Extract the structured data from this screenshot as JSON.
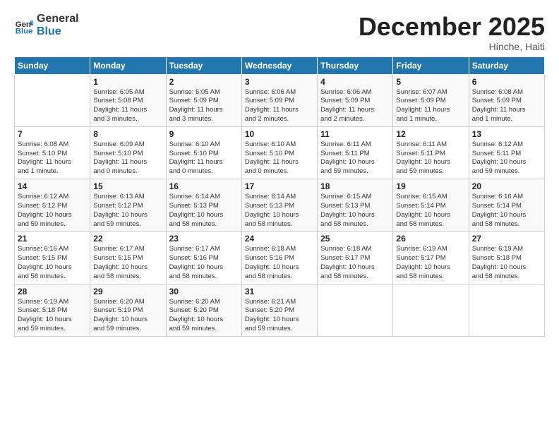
{
  "header": {
    "logo_general": "General",
    "logo_blue": "Blue",
    "title": "December 2025",
    "subtitle": "Hinche, Haiti"
  },
  "days_of_week": [
    "Sunday",
    "Monday",
    "Tuesday",
    "Wednesday",
    "Thursday",
    "Friday",
    "Saturday"
  ],
  "weeks": [
    [
      {
        "day": "",
        "info": ""
      },
      {
        "day": "1",
        "info": "Sunrise: 6:05 AM\nSunset: 5:08 PM\nDaylight: 11 hours\nand 3 minutes."
      },
      {
        "day": "2",
        "info": "Sunrise: 6:05 AM\nSunset: 5:09 PM\nDaylight: 11 hours\nand 3 minutes."
      },
      {
        "day": "3",
        "info": "Sunrise: 6:06 AM\nSunset: 5:09 PM\nDaylight: 11 hours\nand 2 minutes."
      },
      {
        "day": "4",
        "info": "Sunrise: 6:06 AM\nSunset: 5:09 PM\nDaylight: 11 hours\nand 2 minutes."
      },
      {
        "day": "5",
        "info": "Sunrise: 6:07 AM\nSunset: 5:09 PM\nDaylight: 11 hours\nand 1 minute."
      },
      {
        "day": "6",
        "info": "Sunrise: 6:08 AM\nSunset: 5:09 PM\nDaylight: 11 hours\nand 1 minute."
      }
    ],
    [
      {
        "day": "7",
        "info": "Sunrise: 6:08 AM\nSunset: 5:10 PM\nDaylight: 11 hours\nand 1 minute."
      },
      {
        "day": "8",
        "info": "Sunrise: 6:09 AM\nSunset: 5:10 PM\nDaylight: 11 hours\nand 0 minutes."
      },
      {
        "day": "9",
        "info": "Sunrise: 6:10 AM\nSunset: 5:10 PM\nDaylight: 11 hours\nand 0 minutes."
      },
      {
        "day": "10",
        "info": "Sunrise: 6:10 AM\nSunset: 5:10 PM\nDaylight: 11 hours\nand 0 minutes."
      },
      {
        "day": "11",
        "info": "Sunrise: 6:11 AM\nSunset: 5:11 PM\nDaylight: 10 hours\nand 59 minutes."
      },
      {
        "day": "12",
        "info": "Sunrise: 6:11 AM\nSunset: 5:11 PM\nDaylight: 10 hours\nand 59 minutes."
      },
      {
        "day": "13",
        "info": "Sunrise: 6:12 AM\nSunset: 5:11 PM\nDaylight: 10 hours\nand 59 minutes."
      }
    ],
    [
      {
        "day": "14",
        "info": "Sunrise: 6:12 AM\nSunset: 5:12 PM\nDaylight: 10 hours\nand 59 minutes."
      },
      {
        "day": "15",
        "info": "Sunrise: 6:13 AM\nSunset: 5:12 PM\nDaylight: 10 hours\nand 59 minutes."
      },
      {
        "day": "16",
        "info": "Sunrise: 6:14 AM\nSunset: 5:13 PM\nDaylight: 10 hours\nand 58 minutes."
      },
      {
        "day": "17",
        "info": "Sunrise: 6:14 AM\nSunset: 5:13 PM\nDaylight: 10 hours\nand 58 minutes."
      },
      {
        "day": "18",
        "info": "Sunrise: 6:15 AM\nSunset: 5:13 PM\nDaylight: 10 hours\nand 58 minutes."
      },
      {
        "day": "19",
        "info": "Sunrise: 6:15 AM\nSunset: 5:14 PM\nDaylight: 10 hours\nand 58 minutes."
      },
      {
        "day": "20",
        "info": "Sunrise: 6:16 AM\nSunset: 5:14 PM\nDaylight: 10 hours\nand 58 minutes."
      }
    ],
    [
      {
        "day": "21",
        "info": "Sunrise: 6:16 AM\nSunset: 5:15 PM\nDaylight: 10 hours\nand 58 minutes."
      },
      {
        "day": "22",
        "info": "Sunrise: 6:17 AM\nSunset: 5:15 PM\nDaylight: 10 hours\nand 58 minutes."
      },
      {
        "day": "23",
        "info": "Sunrise: 6:17 AM\nSunset: 5:16 PM\nDaylight: 10 hours\nand 58 minutes."
      },
      {
        "day": "24",
        "info": "Sunrise: 6:18 AM\nSunset: 5:16 PM\nDaylight: 10 hours\nand 58 minutes."
      },
      {
        "day": "25",
        "info": "Sunrise: 6:18 AM\nSunset: 5:17 PM\nDaylight: 10 hours\nand 58 minutes."
      },
      {
        "day": "26",
        "info": "Sunrise: 6:19 AM\nSunset: 5:17 PM\nDaylight: 10 hours\nand 58 minutes."
      },
      {
        "day": "27",
        "info": "Sunrise: 6:19 AM\nSunset: 5:18 PM\nDaylight: 10 hours\nand 58 minutes."
      }
    ],
    [
      {
        "day": "28",
        "info": "Sunrise: 6:19 AM\nSunset: 5:18 PM\nDaylight: 10 hours\nand 59 minutes."
      },
      {
        "day": "29",
        "info": "Sunrise: 6:20 AM\nSunset: 5:19 PM\nDaylight: 10 hours\nand 59 minutes."
      },
      {
        "day": "30",
        "info": "Sunrise: 6:20 AM\nSunset: 5:20 PM\nDaylight: 10 hours\nand 59 minutes."
      },
      {
        "day": "31",
        "info": "Sunrise: 6:21 AM\nSunset: 5:20 PM\nDaylight: 10 hours\nand 59 minutes."
      },
      {
        "day": "",
        "info": ""
      },
      {
        "day": "",
        "info": ""
      },
      {
        "day": "",
        "info": ""
      }
    ]
  ]
}
